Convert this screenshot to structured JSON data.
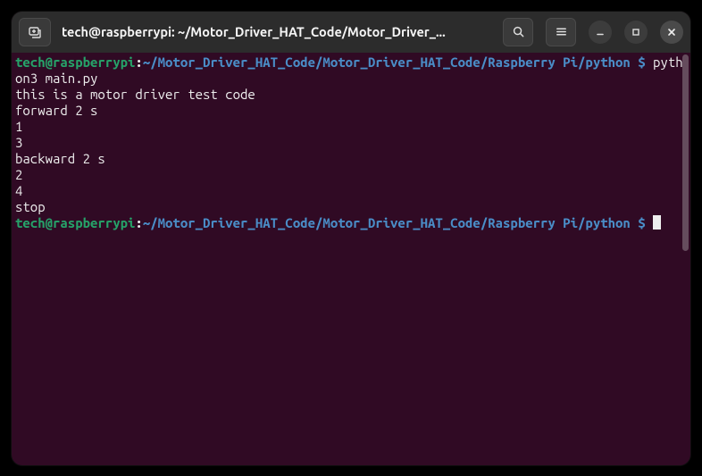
{
  "titlebar": {
    "title": "tech@raspberrypi: ~/Motor_Driver_HAT_Code/Motor_Driver_..."
  },
  "prompt1": {
    "user": "tech@raspberrypi",
    "separator": ":",
    "path": "~/Motor_Driver_HAT_Code/Motor_Driver_HAT_Code/Raspberry Pi/python",
    "dollar": " $ ",
    "command": "python3 main.py"
  },
  "output": {
    "l1": "this is a motor driver test code",
    "l2": "forward 2 s",
    "l3": "1",
    "l4": "3",
    "l5": "backward 2 s",
    "l6": "2",
    "l7": "4",
    "l8": "stop"
  },
  "prompt2": {
    "user": "tech@raspberrypi",
    "separator": ":",
    "path": "~/Motor_Driver_HAT_Code/Motor_Driver_HAT_Code/Raspberry Pi/python",
    "dollar": " $ "
  }
}
